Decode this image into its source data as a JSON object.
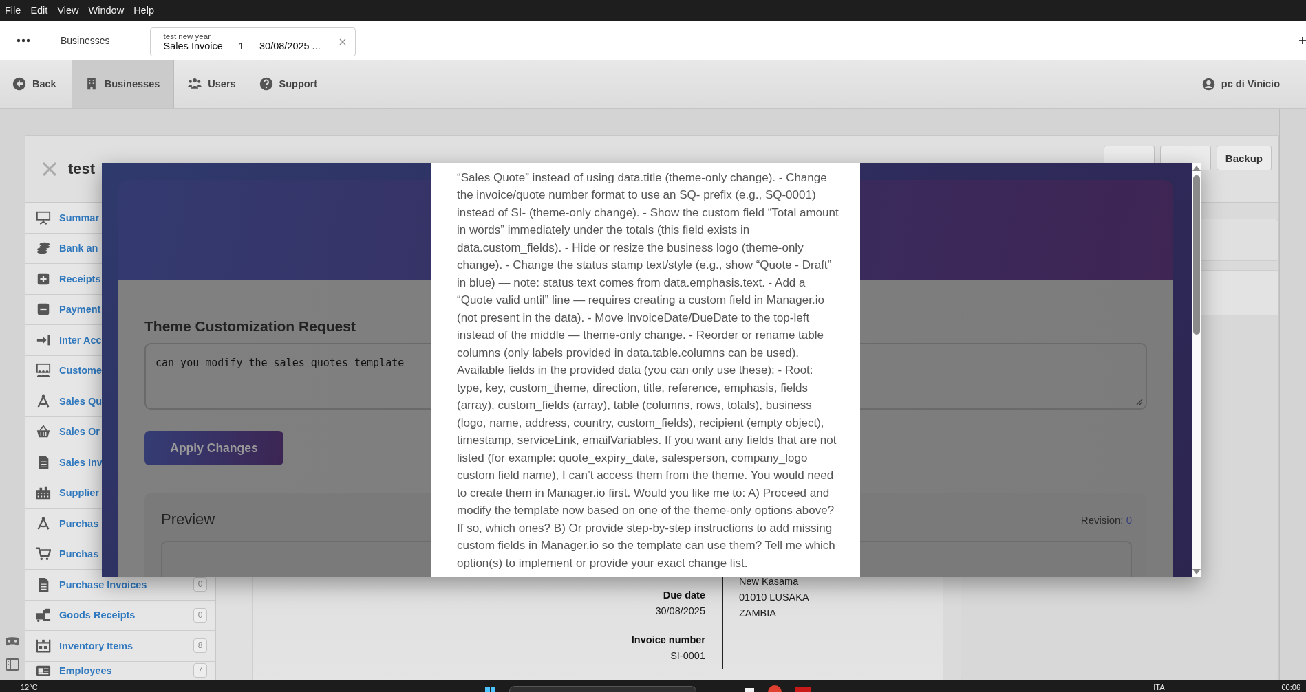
{
  "menu_bar": [
    "File",
    "Edit",
    "View",
    "Window",
    "Help"
  ],
  "tab_bar": {
    "tabs": [
      {
        "label": "Businesses",
        "selected": false
      },
      {
        "subtitle": "test new year",
        "label": "Sales Invoice — 1 — 30/08/2025 ...",
        "selected": true
      }
    ]
  },
  "toolbar": {
    "items": [
      {
        "label": "Back",
        "kind": "back",
        "selected": false
      },
      {
        "label": "Businesses",
        "kind": "building",
        "selected": true
      },
      {
        "label": "Users",
        "kind": "users",
        "selected": false
      },
      {
        "label": "Support",
        "kind": "help",
        "selected": false
      }
    ],
    "user": "pc di Vinicio"
  },
  "business": {
    "title": "test",
    "buttons": [
      "Backup"
    ]
  },
  "sidebar": {
    "items": [
      {
        "label": "Summar",
        "kind": "presentation"
      },
      {
        "label": "Bank an",
        "kind": "coins"
      },
      {
        "label": "Receipts",
        "kind": "plus"
      },
      {
        "label": "Payment",
        "kind": "minus"
      },
      {
        "label": "Inter Acc",
        "kind": "transfer"
      },
      {
        "label": "Custome",
        "kind": "customers"
      },
      {
        "label": "Sales Qu",
        "kind": "compass"
      },
      {
        "label": "Sales Or",
        "kind": "basket"
      },
      {
        "label": "Sales Inv",
        "kind": "document"
      },
      {
        "label": "Supplier",
        "kind": "buildings"
      },
      {
        "label": "Purchas",
        "kind": "compass"
      },
      {
        "label": "Purchas",
        "kind": "cart"
      },
      {
        "label": "Purchase Invoices",
        "kind": "document",
        "count": "0"
      },
      {
        "label": "Goods Receipts",
        "kind": "forklift",
        "count": "0"
      },
      {
        "label": "Inventory Items",
        "kind": "shelf",
        "count": "8"
      },
      {
        "label": "Employees",
        "kind": "idcard",
        "count": "7"
      }
    ]
  },
  "document": {
    "fields": [
      {
        "label": "Due date",
        "value": "30/08/2025"
      },
      {
        "label": "Invoice number",
        "value": "SI-0001"
      }
    ],
    "address": [
      "New Kasama",
      "01010 LUSAKA",
      "ZAMBIA"
    ]
  },
  "modal": {
    "heading": "Theme Customization Request",
    "request": "can you modify the sales quotes template",
    "apply_button": "Apply Changes",
    "preview": {
      "title": "Preview",
      "revision_label": "Revision:",
      "revision": "0"
    },
    "reply": "“Sales Quote” instead of using data.title (theme-only change). - Change the invoice/quote number format to use an SQ- prefix (e.g., SQ-0001) instead of SI- (theme-only change). - Show the custom field “Total amount in words” immediately under the totals (this field exists in data.custom_fields). - Hide or resize the business logo (theme-only change). - Change the status stamp text/style (e.g., show “Quote - Draft” in blue) — note: status text comes from data.emphasis.text. - Add a “Quote valid until” line — requires creating a custom field in Manager.io (not present in the data). - Move InvoiceDate/DueDate to the top-left instead of the middle — theme-only change. - Reorder or rename table columns (only labels provided in data.table.columns can be used). Available fields in the provided data (you can only use these): - Root: type, key, custom_theme, direction, title, reference, emphasis, fields (array), custom_fields (array), table (columns, rows, totals), business (logo, name, address, country, custom_fields), recipient (empty object), timestamp, serviceLink, emailVariables. If you want any fields that are not listed (for example: quote_expiry_date, salesperson, company_logo custom field name), I can’t access them from the theme. You would need to create them in Manager.io first. Would you like me to: A) Proceed and modify the template now based on one of the theme-only options above? If so, which ones? B) Or provide step-by-step instructions to add missing custom fields in Manager.io so the template can use them? Tell me which option(s) to implement or provide your exact change list."
  },
  "taskbar": {
    "weather": "12°C",
    "language": "ITA",
    "clock": "00:06"
  }
}
